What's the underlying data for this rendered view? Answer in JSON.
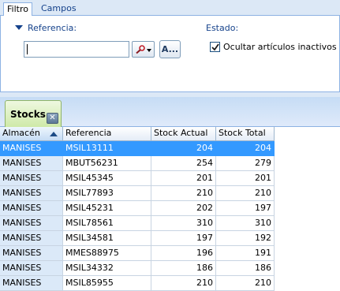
{
  "tabs": [
    {
      "label": "Filtro",
      "active": true
    },
    {
      "label": "Campos",
      "active": false
    }
  ],
  "filter": {
    "referencia_label": "Referencia:",
    "referencia_value": "",
    "advanced_button_label": "A...",
    "estado_label": "Estado:",
    "hide_inactive_label": "Ocultar artículos inactivos",
    "hide_inactive_checked": true
  },
  "stocks_tab": {
    "label": "Stocks"
  },
  "grid": {
    "columns": [
      "Almacén",
      "Referencia",
      "Stock Actual",
      "Stock Total"
    ],
    "sorted_column": "Almacén",
    "sort_direction": "ascending",
    "rows": [
      {
        "almacen": "MANISES",
        "referencia": "MSIL13111",
        "stock_actual": "204",
        "stock_total": "204",
        "selected": true
      },
      {
        "almacen": "MANISES",
        "referencia": "MBUT56231",
        "stock_actual": "254",
        "stock_total": "279"
      },
      {
        "almacen": "MANISES",
        "referencia": "MSIL45345",
        "stock_actual": "201",
        "stock_total": "201"
      },
      {
        "almacen": "MANISES",
        "referencia": "MSIL77893",
        "stock_actual": "210",
        "stock_total": "210"
      },
      {
        "almacen": "MANISES",
        "referencia": "MSIL45231",
        "stock_actual": "202",
        "stock_total": "197"
      },
      {
        "almacen": "MANISES",
        "referencia": "MSIL78561",
        "stock_actual": "310",
        "stock_total": "310"
      },
      {
        "almacen": "MANISES",
        "referencia": "MSIL34581",
        "stock_actual": "197",
        "stock_total": "192"
      },
      {
        "almacen": "MANISES",
        "referencia": "MMES88975",
        "stock_actual": "196",
        "stock_total": "191"
      },
      {
        "almacen": "MANISES",
        "referencia": "MSIL34332",
        "stock_actual": "186",
        "stock_total": "186"
      },
      {
        "almacen": "MANISES",
        "referencia": "MSIL85955",
        "stock_actual": "210",
        "stock_total": "210"
      }
    ]
  },
  "colors": {
    "selection": "#3399ff",
    "header_text": "#15428b",
    "tab_green": "#cfe9a8"
  }
}
